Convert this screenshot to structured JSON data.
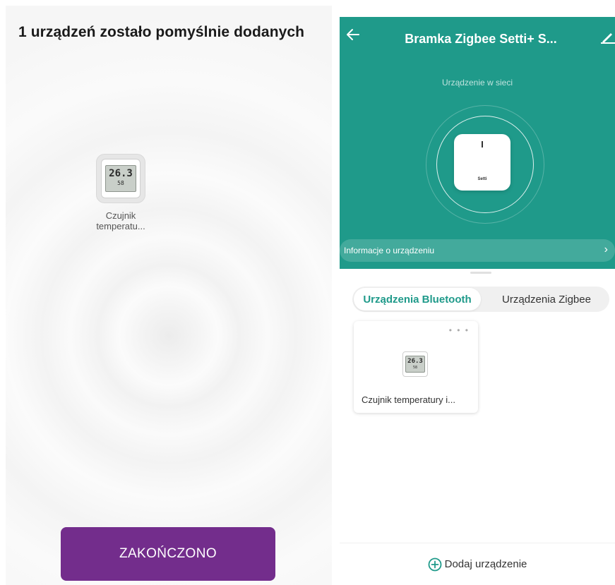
{
  "left": {
    "title": "1 urządzeń zostało pomyślnie dodanych",
    "device": {
      "display_temp": "26.3",
      "display_humidity": "58",
      "label_line1": "Czujnik",
      "label_line2": "temperatu..."
    },
    "finish_button": "ZAKOŃCZONO",
    "accent_color": "#732d8c"
  },
  "right": {
    "header": {
      "title": "Bramka Zigbee Setti+ S...",
      "status": "Urządzenie w sieci",
      "device_brand": "Setti",
      "info_bar": "Informacje o urządzeniu",
      "background_color": "#1f9a8a"
    },
    "tabs": [
      {
        "label": "Urządzenia Bluetooth",
        "active": true
      },
      {
        "label": "Urządzenia Zigbee",
        "active": false
      }
    ],
    "devices": [
      {
        "name": "Czujnik temperatury i...",
        "display_temp": "26.3",
        "display_humidity": "58"
      }
    ],
    "add_device": "Dodaj urządzenie",
    "icons": {
      "back": "arrow-left-icon",
      "edit": "pencil-icon",
      "info": "chevron-right-icon",
      "more": "more-dots-icon",
      "add": "plus-circle-icon"
    }
  }
}
